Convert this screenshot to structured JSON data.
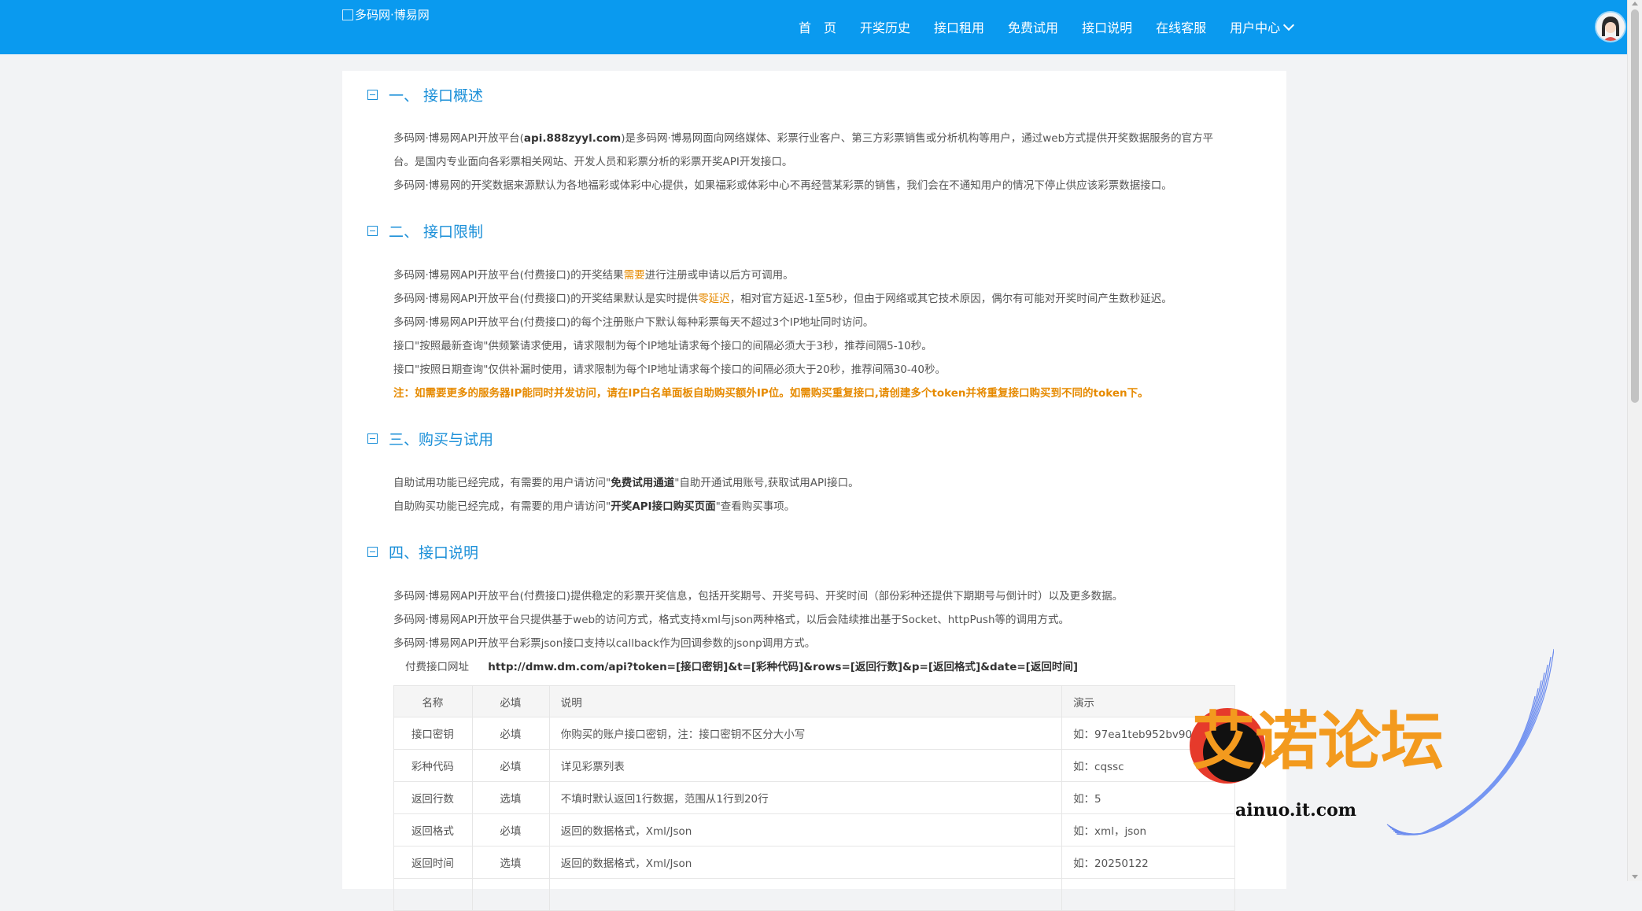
{
  "header": {
    "logo_alt": "多码网·博易网",
    "nav": [
      {
        "label": "首　页"
      },
      {
        "label": "开奖历史"
      },
      {
        "label": "接口租用"
      },
      {
        "label": "免费试用"
      },
      {
        "label": "接口说明"
      },
      {
        "label": "在线客服"
      },
      {
        "label": "用户中心"
      }
    ]
  },
  "sections": {
    "s1": {
      "title": "一、 接口概述",
      "p1a": "多码网·博易网API开放平台(",
      "p1b": "api.888zyyl.com",
      "p1c": ")是多码网·博易网面向网络媒体、彩票行业客户、第三方彩票销售或分析机构等用户，通过web方式提供开奖数据服务的官方平",
      "p2": "台。是国内专业面向各彩票相关网站、开发人员和彩票分析的彩票开奖API开发接口。",
      "p3": "多码网·博易网的开奖数据来源默认为各地福彩或体彩中心提供，如果福彩或体彩中心不再经营某彩票的销售，我们会在不通知用户的情况下停止供应该彩票数据接口。"
    },
    "s2": {
      "title": "二、 接口限制",
      "p1a": "多码网·博易网API开放平台(付费接口)的开奖结果",
      "p1b": "需要",
      "p1c": "进行注册或申请以后方可调用。",
      "p2a": "多码网·博易网API开放平台(付费接口)的开奖结果默认是实时提供",
      "p2b": "零延迟",
      "p2c": "，相对官方延迟-1至5秒，但由于网络或其它技术原因，偶尔有可能对开奖时间产生数秒延迟。",
      "p3": "多码网·博易网API开放平台(付费接口)的每个注册账户下默认每种彩票每天不超过3个IP地址同时访问。",
      "p4": "接口\"按照最新查询\"供频繁请求使用，请求限制为每个IP地址请求每个接口的间隔必须大于3秒，推荐间隔5-10秒。",
      "p5": "接口\"按照日期查询\"仅供补漏时使用，请求限制为每个IP地址请求每个接口的间隔必须大于20秒，推荐间隔30-40秒。",
      "note": "注：如需要更多的服务器IP能同时并发访问，请在IP白名单面板自助购买额外IP位。如需购买重复接口,请创建多个token并将重复接口购买到不同的token下。"
    },
    "s3": {
      "title": "三、购买与试用",
      "p1a": "自助试用功能已经完成，有需要的用户请访问\"",
      "p1b": "免费试用通道",
      "p1c": "\"自助开通试用账号,获取试用API接口。",
      "p2a": "自助购买功能已经完成，有需要的用户请访问\"",
      "p2b": "开奖API接口购买页面",
      "p2c": "\"查看购买事项。"
    },
    "s4": {
      "title": "四、接口说明",
      "p1": "多码网·博易网API开放平台(付费接口)提供稳定的彩票开奖信息，包括开奖期号、开奖号码、开奖时间（部份彩种还提供下期期号与倒计时）以及更多数据。",
      "p2": "多码网·博易网API开放平台只提供基于web的访问方式，格式支持xml与json两种格式，以后会陆续推出基于Socket、httpPush等的调用方式。",
      "p3": "多码网·博易网API开放平台彩票json接口支持以callback作为回调参数的jsonp调用方式。",
      "url_label": "付费接口网址",
      "url_parts": [
        "http://dmw.dm.com/api?token=",
        "[接口密钥]",
        "&t=",
        "[彩种代码]",
        "&rows=",
        "[返回行数]",
        "&p=",
        "[返回格式]",
        "&date=",
        "[返回时间]"
      ]
    }
  },
  "table": {
    "headers": [
      "名称",
      "必填",
      "说明",
      "演示"
    ],
    "rows": [
      {
        "name": "接口密钥",
        "req": "必填",
        "desc": "你购买的账户接口密钥，注：接口密钥不区分大小写",
        "demo": "如：97ea1teb952bv903"
      },
      {
        "name": "彩种代码",
        "req": "必填",
        "desc": "详见彩票列表",
        "demo": "如：cqssc"
      },
      {
        "name": "返回行数",
        "req": "选填",
        "desc": "不填时默认返回1行数据，范围从1行到20行",
        "demo": "如：5"
      },
      {
        "name": "返回格式",
        "req": "必填",
        "desc": "返回的数据格式，Xml/Json",
        "demo": "如：xml，json"
      },
      {
        "name": "返回时间",
        "req": "选填",
        "desc": "返回的数据格式，Xml/Json",
        "demo": "如：20250122"
      }
    ]
  },
  "watermark": {
    "text": "艾诺论坛",
    "domain": "ainuo.it.com"
  },
  "colors": {
    "header": "#0a9aef",
    "accent": "#1a8fd8",
    "highlight": "#e68a00"
  }
}
